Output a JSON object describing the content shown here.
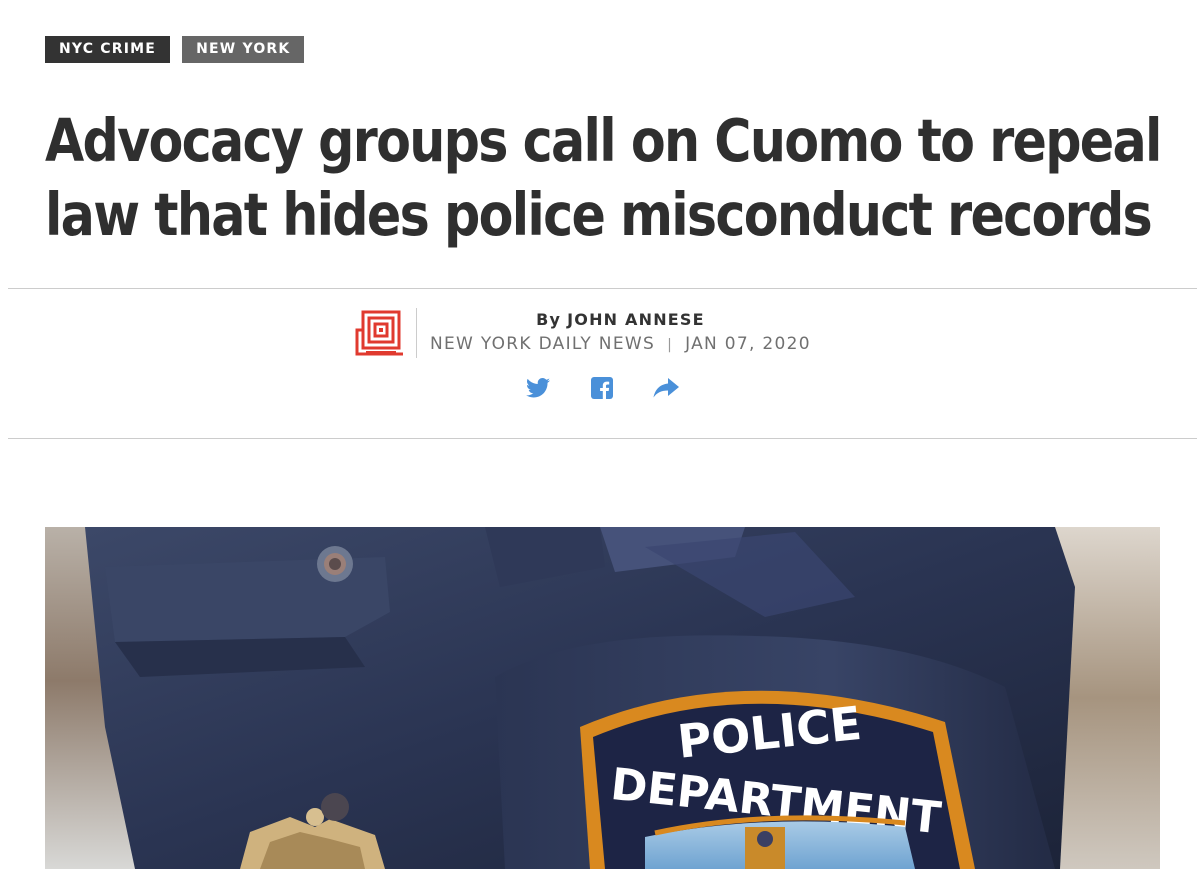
{
  "tags": [
    "NYC CRIME",
    "NEW YORK"
  ],
  "headline": {
    "line1": "Advocacy groups call on Cuomo to repeal",
    "line2": "law that hides police misconduct records"
  },
  "byline": {
    "prefix": "By",
    "author": "JOHN ANNESE",
    "publication": "NEW YORK DAILY NEWS",
    "separator": "|",
    "date": "JAN 07, 2020"
  },
  "share": {
    "icons": [
      "twitter-icon",
      "facebook-icon",
      "share-arrow-icon"
    ],
    "color": "#4a90d9"
  },
  "hero_image": {
    "patch_line1": "POLICE",
    "patch_line2": "DEPARTMENT"
  },
  "colors": {
    "tag_dark": "#333333",
    "tag_grey": "#666666",
    "headline": "#2f2f2f",
    "logo_red": "#e03a2f"
  }
}
